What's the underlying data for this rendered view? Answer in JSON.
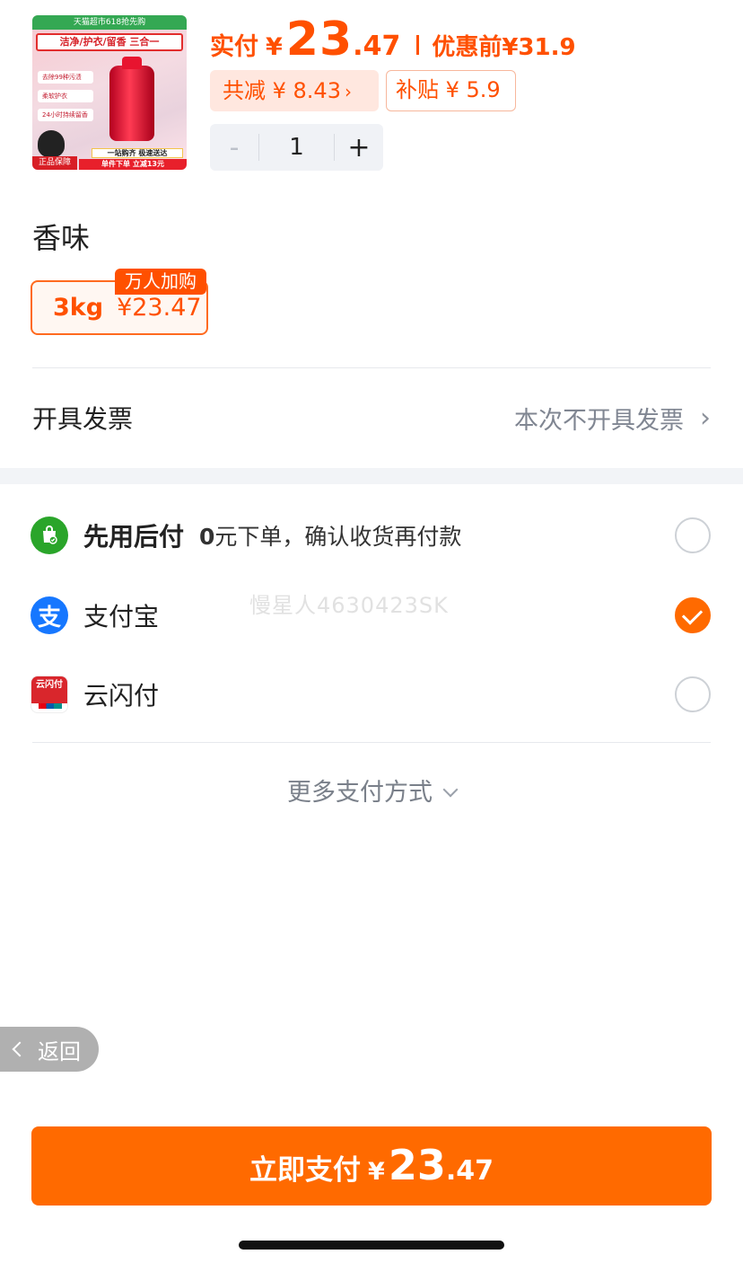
{
  "product": {
    "thumb": {
      "topbar": "天猫超市618抢先购",
      "banner": "洁净/护衣/留香 三合一",
      "tags": [
        "去除99种污渍",
        "柔软护衣",
        "24小时持续留香"
      ],
      "promo1": "一站购齐 极速送达",
      "promo2": "单件下单 立减13元",
      "guarantee": "正品保障"
    },
    "price_label": "实付",
    "currency": "¥",
    "price_int": "23",
    "price_dec": ".47",
    "before_label": "优惠前",
    "before_price": "¥31.9",
    "discount": "共减 ¥ 8.43",
    "subsidy": "补贴 ¥ 5.9",
    "quantity": "1",
    "minus": "-",
    "plus": "+"
  },
  "spec": {
    "title": "香味",
    "option_size": "3kg",
    "option_price": "¥23.47",
    "badge": "万人加购"
  },
  "invoice": {
    "label": "开具发票",
    "value": "本次不开具发票"
  },
  "payment": {
    "options": [
      {
        "name": "先用后付",
        "desc_bold": "0",
        "desc": "元下单，确认收货再付款",
        "selected": false
      },
      {
        "name": "支付宝",
        "selected": true
      },
      {
        "name": "云闪付",
        "icon_text": "云闪付",
        "selected": false
      }
    ],
    "watermark": "慢星人4630423SK",
    "more": "更多支付方式"
  },
  "back": {
    "label": "返回"
  },
  "pay_button": {
    "label": "立即支付",
    "currency": "¥",
    "int": "23",
    "dec": ".47"
  },
  "colors": {
    "accent": "#ff5000",
    "pay_button": "#ff6a00",
    "afterpay_icon": "#2aa52a",
    "alipay_icon": "#1677ff",
    "unionpay_icon": "#d9262c"
  },
  "icons": {
    "afterpay": "shopping-bag-check-icon",
    "alipay": "alipay-icon",
    "unionpay": "unionpay-icon",
    "invoice_chevron": "chevron-right-icon",
    "more_chevron": "chevron-down-icon",
    "back_chevron": "chevron-left-icon"
  }
}
